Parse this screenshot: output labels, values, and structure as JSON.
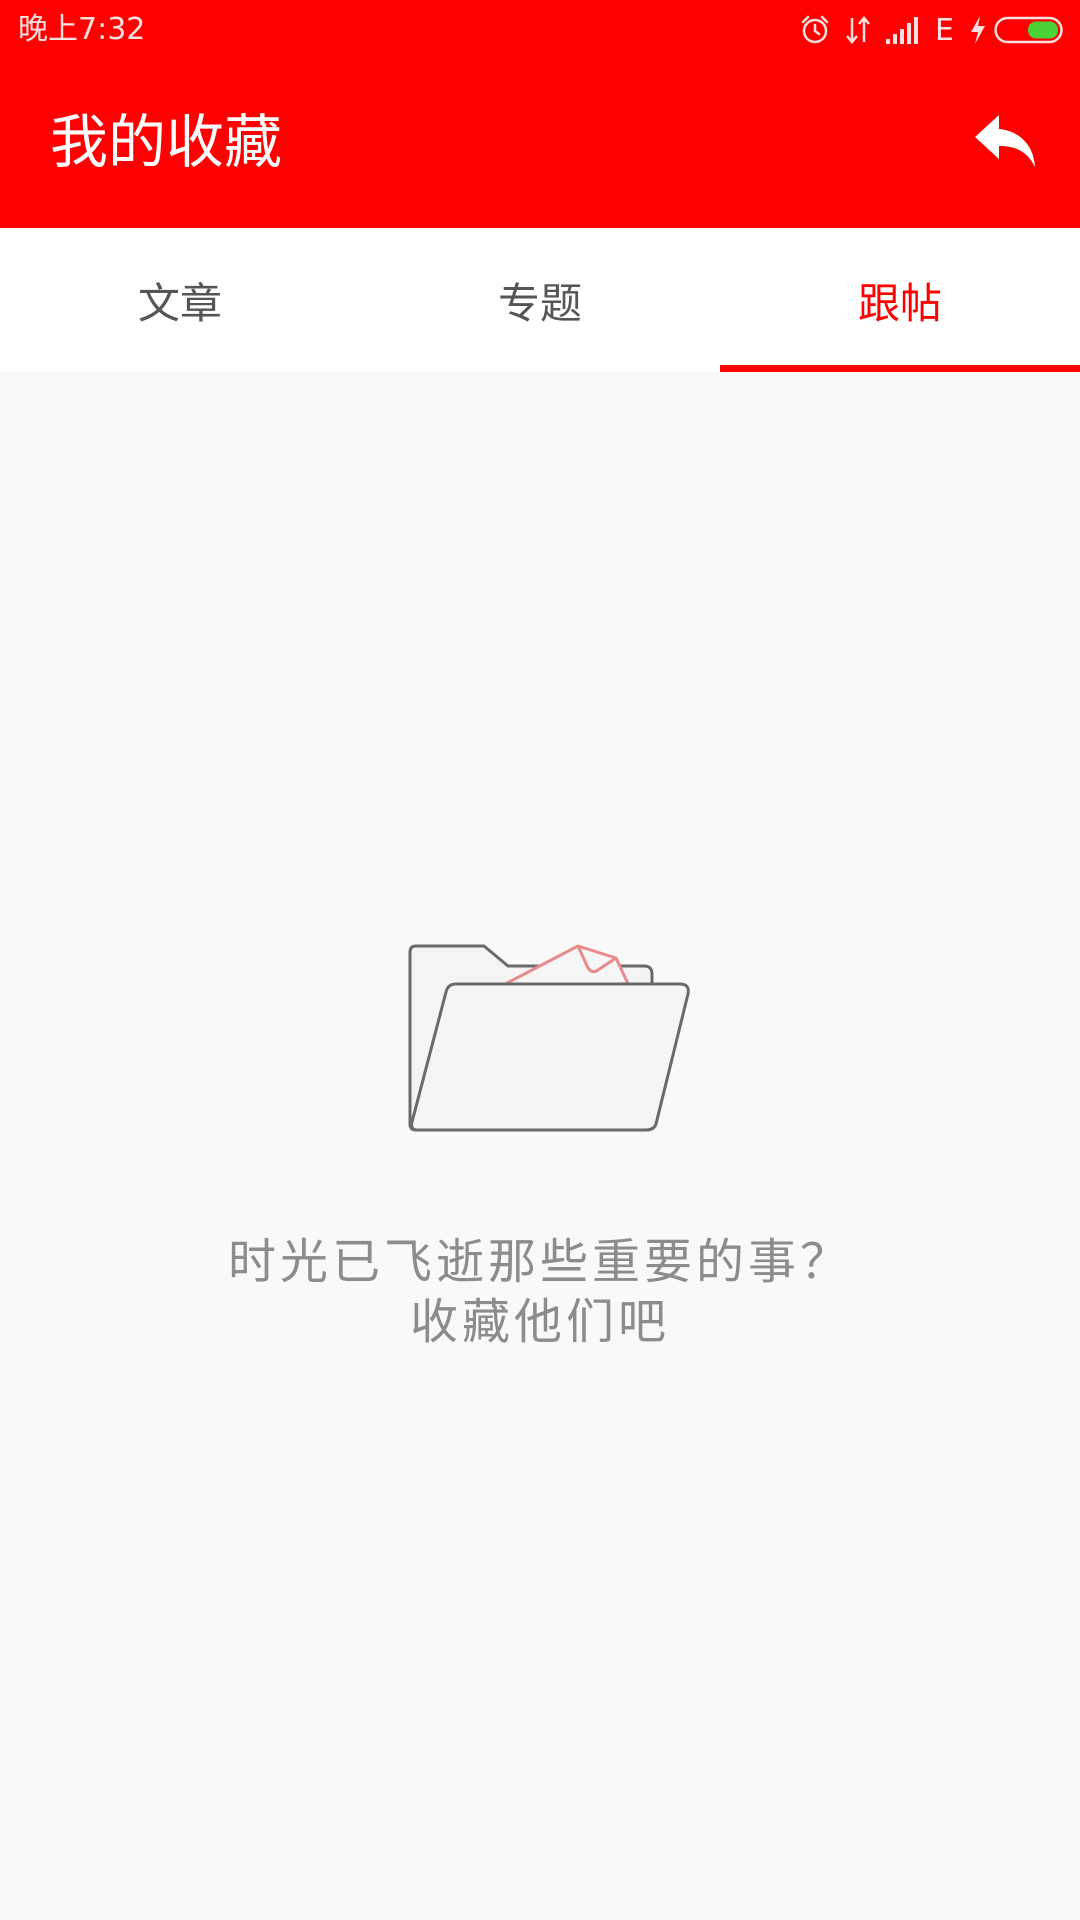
{
  "status_bar": {
    "time": "晚上7:32",
    "network": "E",
    "icons": [
      "alarm-icon",
      "data-transfer-icon",
      "signal-icon",
      "charging-icon",
      "battery-icon"
    ],
    "battery_color": "#4cd137"
  },
  "toolbar": {
    "title": "我的收藏",
    "back_icon": "reply-arrow-icon"
  },
  "tabs": [
    {
      "label": "文章",
      "active": false
    },
    {
      "label": "专题",
      "active": false
    },
    {
      "label": "跟帖",
      "active": true
    }
  ],
  "empty_state": {
    "icon": "empty-folder-icon",
    "line1": "时光已飞逝那些重要的事？",
    "line2": "收藏他们吧"
  },
  "colors": {
    "accent": "#ff0000",
    "tab_inactive": "#555555",
    "background": "#f9f9f9",
    "message_text": "#8c8c8c"
  }
}
